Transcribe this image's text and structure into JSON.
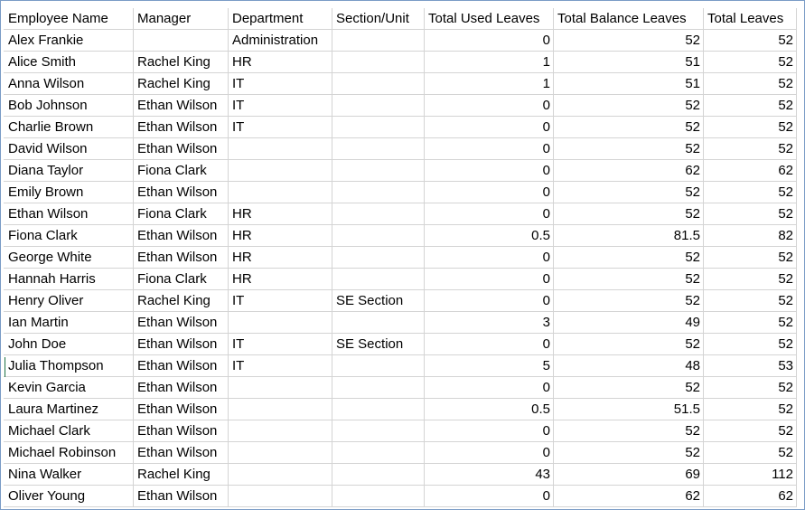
{
  "colors": {
    "frame_border": "#7a9cc6",
    "gridline": "#d4d4d4",
    "active_cell_marker": "#217346"
  },
  "columns": [
    "Employee Name",
    "Manager",
    "Department",
    "Section/Unit",
    "Total Used Leaves",
    "Total Balance Leaves",
    "Total Leaves"
  ],
  "rows": [
    [
      "Alex Frankie",
      "",
      "Administration",
      "",
      "0",
      "52",
      "52"
    ],
    [
      "Alice Smith",
      "Rachel King",
      "HR",
      "",
      "1",
      "51",
      "52"
    ],
    [
      "Anna Wilson",
      "Rachel King",
      "IT",
      "",
      "1",
      "51",
      "52"
    ],
    [
      "Bob Johnson",
      "Ethan Wilson",
      "IT",
      "",
      "0",
      "52",
      "52"
    ],
    [
      "Charlie Brown",
      "Ethan Wilson",
      "IT",
      "",
      "0",
      "52",
      "52"
    ],
    [
      "David Wilson",
      "Ethan Wilson",
      "",
      "",
      "0",
      "52",
      "52"
    ],
    [
      "Diana Taylor",
      "Fiona Clark",
      "",
      "",
      "0",
      "62",
      "62"
    ],
    [
      "Emily Brown",
      "Ethan Wilson",
      "",
      "",
      "0",
      "52",
      "52"
    ],
    [
      "Ethan Wilson",
      "Fiona Clark",
      "HR",
      "",
      "0",
      "52",
      "52"
    ],
    [
      "Fiona Clark",
      "Ethan Wilson",
      "HR",
      "",
      "0.5",
      "81.5",
      "82"
    ],
    [
      "George White",
      "Ethan Wilson",
      "HR",
      "",
      "0",
      "52",
      "52"
    ],
    [
      "Hannah Harris",
      "Fiona Clark",
      "HR",
      "",
      "0",
      "52",
      "52"
    ],
    [
      "Henry Oliver",
      "Rachel King",
      "IT",
      "SE Section",
      "0",
      "52",
      "52"
    ],
    [
      "Ian Martin",
      "Ethan Wilson",
      "",
      "",
      "3",
      "49",
      "52"
    ],
    [
      "John Doe",
      "Ethan Wilson",
      "IT",
      "SE Section",
      "0",
      "52",
      "52"
    ],
    [
      "Julia Thompson",
      "Ethan Wilson",
      "IT",
      "",
      "5",
      "48",
      "53"
    ],
    [
      "Kevin Garcia",
      "Ethan Wilson",
      "",
      "",
      "0",
      "52",
      "52"
    ],
    [
      "Laura Martinez",
      "Ethan Wilson",
      "",
      "",
      "0.5",
      "51.5",
      "52"
    ],
    [
      "Michael Clark",
      "Ethan Wilson",
      "",
      "",
      "0",
      "52",
      "52"
    ],
    [
      "Michael Robinson",
      "Ethan Wilson",
      "",
      "",
      "0",
      "52",
      "52"
    ],
    [
      "Nina Walker",
      "Rachel King",
      "",
      "",
      "43",
      "69",
      "112"
    ],
    [
      "Oliver Young",
      "Ethan Wilson",
      "",
      "",
      "0",
      "62",
      "62"
    ]
  ]
}
